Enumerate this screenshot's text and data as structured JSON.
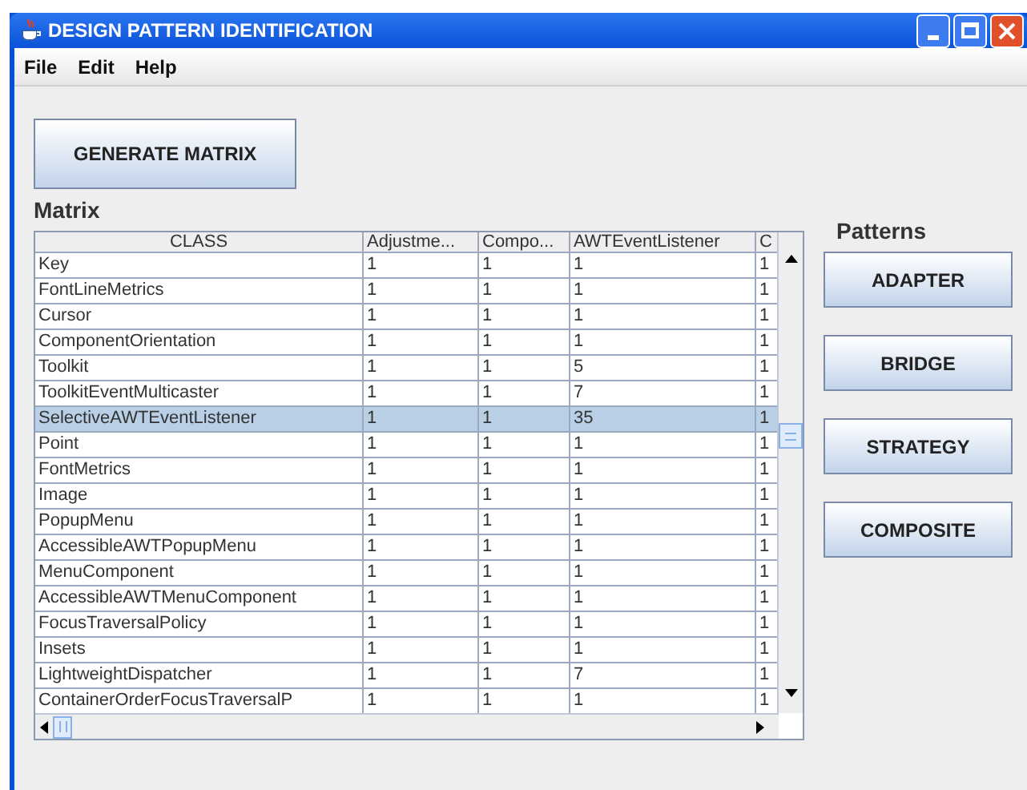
{
  "window": {
    "title": "DESIGN PATTERN IDENTIFICATION"
  },
  "menu": [
    "File",
    "Edit",
    "Help"
  ],
  "generate_button": "GENERATE MATRIX",
  "matrix_label": "Matrix",
  "table": {
    "columns": [
      "CLASS",
      "Adjustme...",
      "Compo...",
      "AWTEventListener",
      "C"
    ],
    "rows": [
      {
        "cells": [
          "Key",
          "1",
          "1",
          "1",
          "1"
        ],
        "selected": false
      },
      {
        "cells": [
          "FontLineMetrics",
          "1",
          "1",
          "1",
          "1"
        ],
        "selected": false
      },
      {
        "cells": [
          "Cursor",
          "1",
          "1",
          "1",
          "1"
        ],
        "selected": false
      },
      {
        "cells": [
          "ComponentOrientation",
          "1",
          "1",
          "1",
          "1"
        ],
        "selected": false
      },
      {
        "cells": [
          "Toolkit",
          "1",
          "1",
          "5",
          "1"
        ],
        "selected": false
      },
      {
        "cells": [
          "ToolkitEventMulticaster",
          "1",
          "1",
          "7",
          "1"
        ],
        "selected": false
      },
      {
        "cells": [
          "SelectiveAWTEventListener",
          "1",
          "1",
          "35",
          "1"
        ],
        "selected": true
      },
      {
        "cells": [
          "Point",
          "1",
          "1",
          "1",
          "1"
        ],
        "selected": false
      },
      {
        "cells": [
          "FontMetrics",
          "1",
          "1",
          "1",
          "1"
        ],
        "selected": false
      },
      {
        "cells": [
          "Image",
          "1",
          "1",
          "1",
          "1"
        ],
        "selected": false
      },
      {
        "cells": [
          "PopupMenu",
          "1",
          "1",
          "1",
          "1"
        ],
        "selected": false
      },
      {
        "cells": [
          "AccessibleAWTPopupMenu",
          "1",
          "1",
          "1",
          "1"
        ],
        "selected": false
      },
      {
        "cells": [
          "MenuComponent",
          "1",
          "1",
          "1",
          "1"
        ],
        "selected": false
      },
      {
        "cells": [
          "AccessibleAWTMenuComponent",
          "1",
          "1",
          "1",
          "1"
        ],
        "selected": false
      },
      {
        "cells": [
          "FocusTraversalPolicy",
          "1",
          "1",
          "1",
          "1"
        ],
        "selected": false
      },
      {
        "cells": [
          "Insets",
          "1",
          "1",
          "1",
          "1"
        ],
        "selected": false
      },
      {
        "cells": [
          "LightweightDispatcher",
          "1",
          "1",
          "7",
          "1"
        ],
        "selected": false
      },
      {
        "cells": [
          "ContainerOrderFocusTraversalP",
          "1",
          "1",
          "1",
          "1"
        ],
        "selected": false
      }
    ]
  },
  "patterns_label": "Patterns",
  "pattern_buttons": [
    "ADAPTER",
    "BRIDGE",
    "STRATEGY",
    "COMPOSITE"
  ]
}
